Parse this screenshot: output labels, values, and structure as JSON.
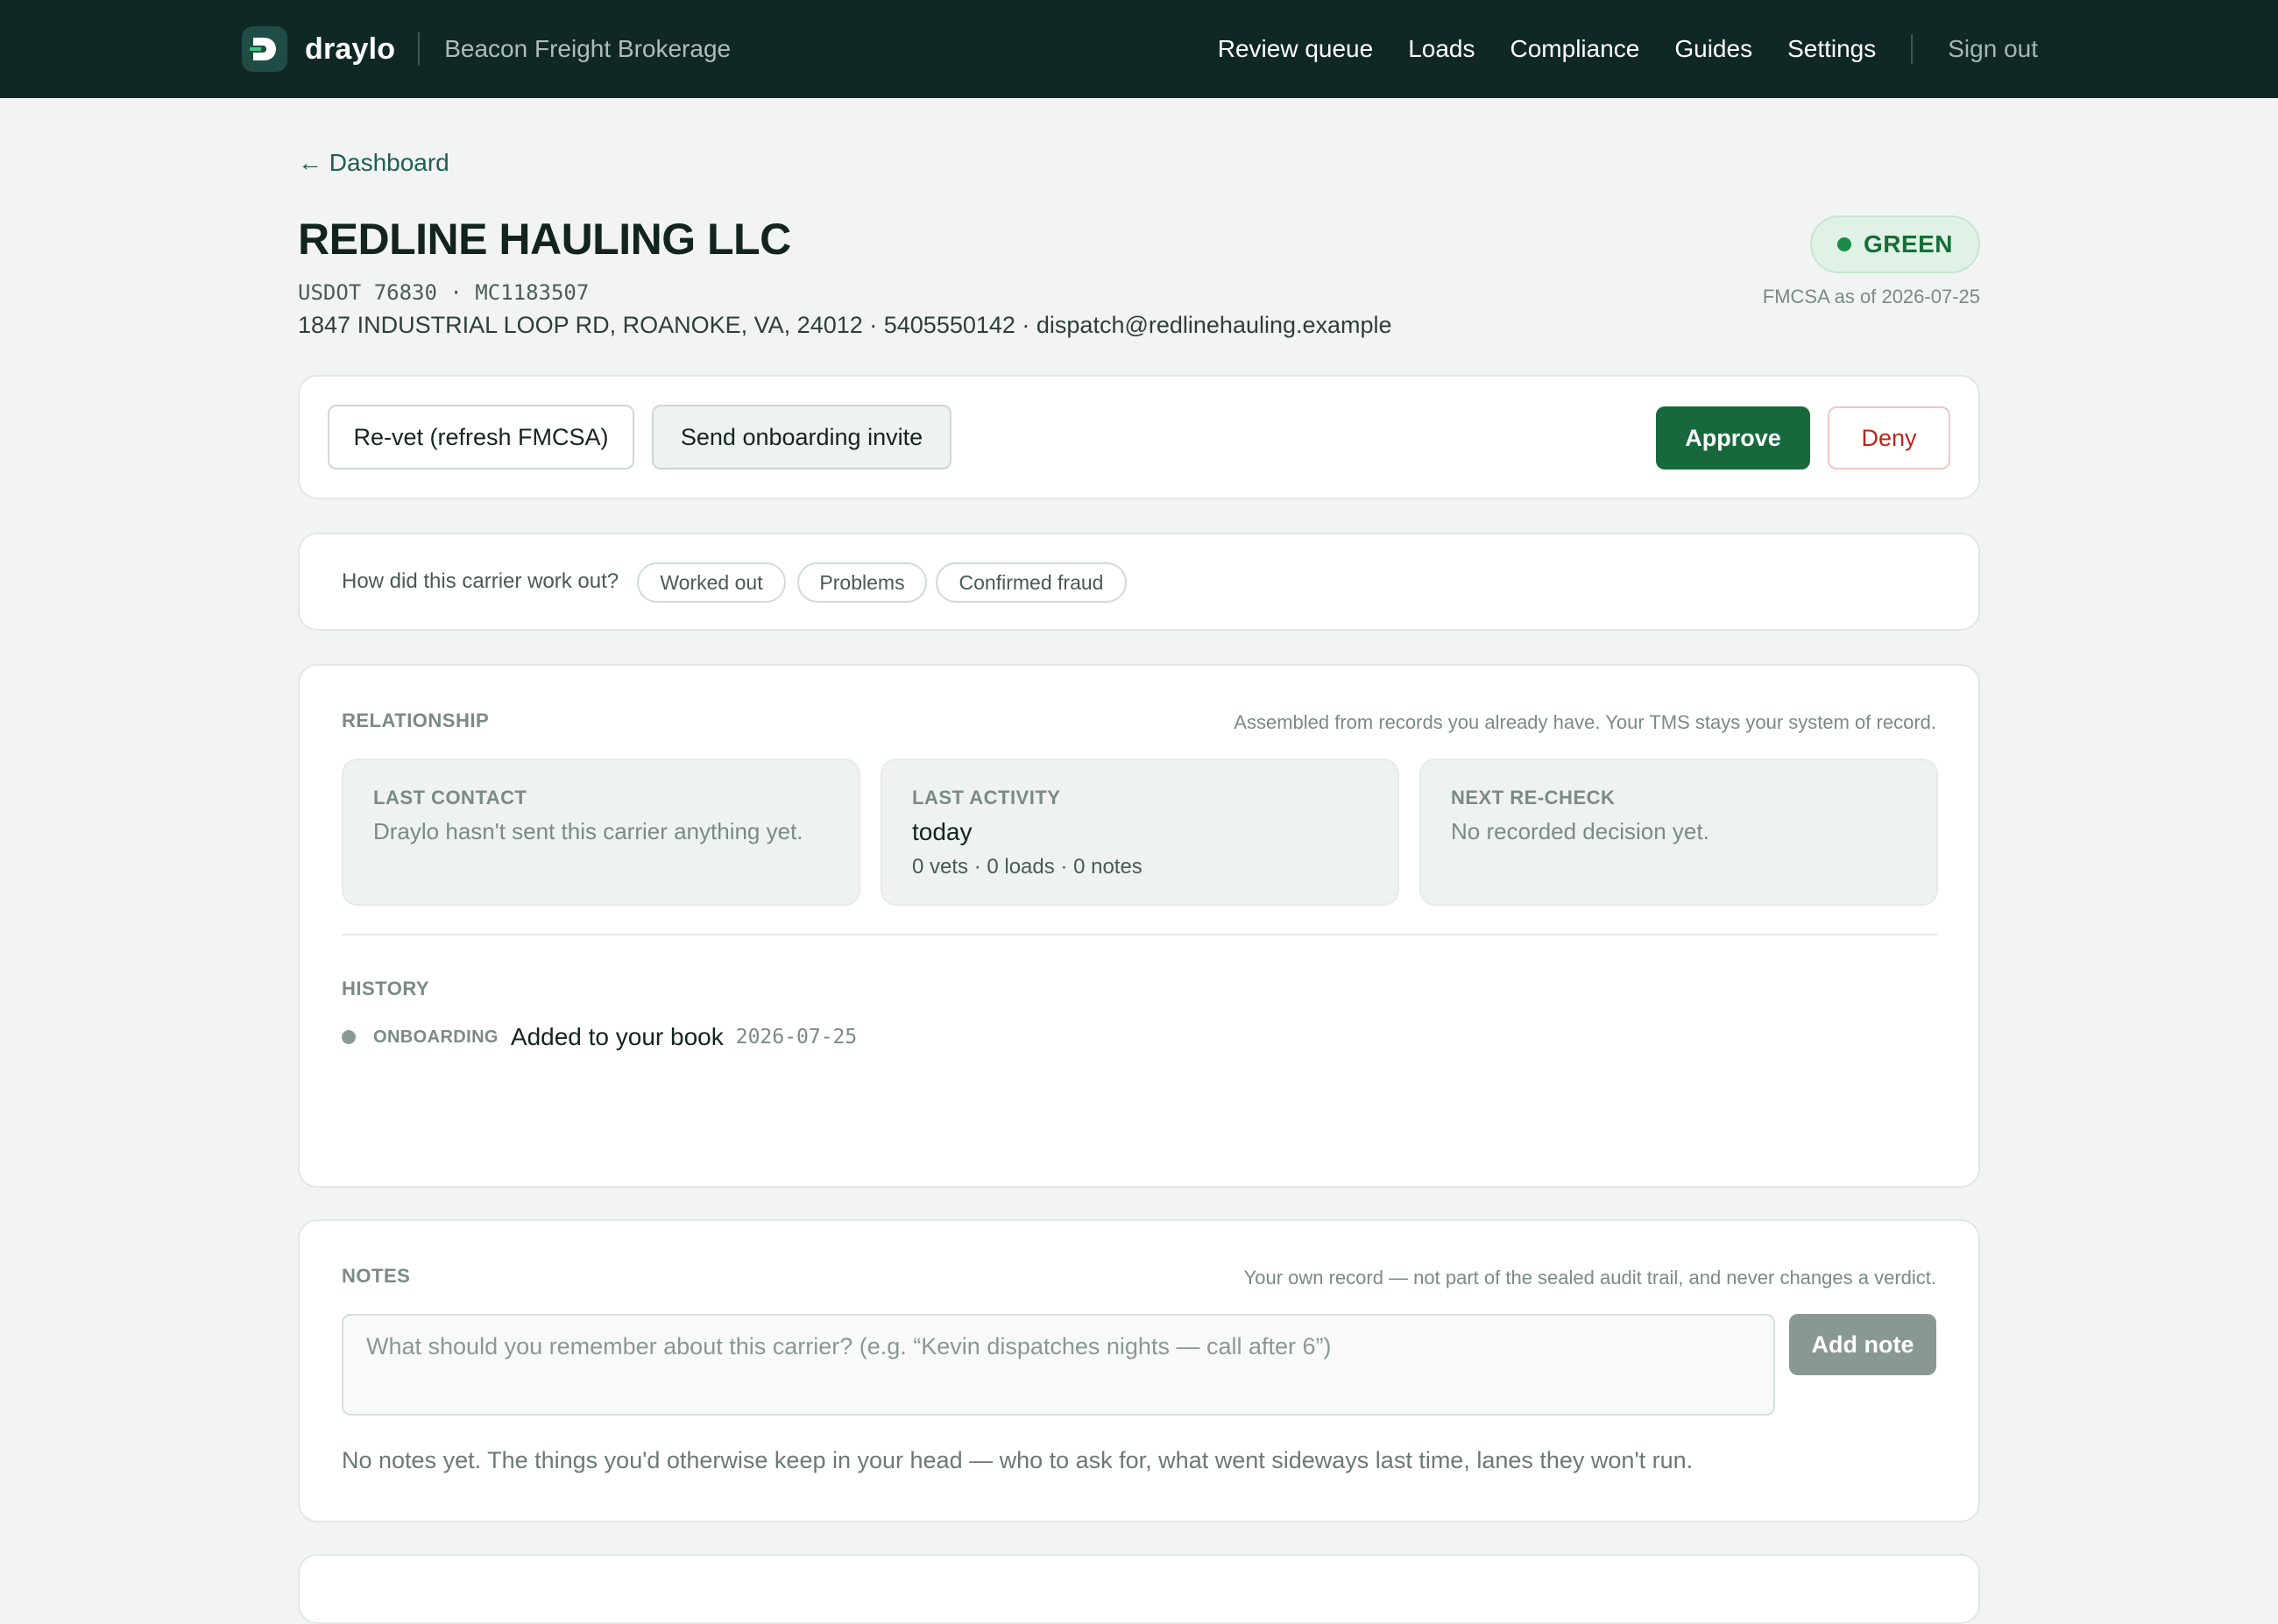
{
  "app": {
    "name": "draylo",
    "org": "Beacon Freight Brokerage"
  },
  "nav": {
    "items": [
      "Review queue",
      "Loads",
      "Compliance",
      "Guides",
      "Settings"
    ],
    "sign_out": "Sign out"
  },
  "breadcrumb": "← Dashboard",
  "carrier": {
    "name": "REDLINE HAULING LLC",
    "ids": "USDOT 76830 · MC1183507",
    "contact_line": "1847 INDUSTRIAL LOOP RD, ROANOKE, VA, 24012 · 5405550142 · dispatch@redlinehauling.example",
    "status": "GREEN",
    "status_color": "#1a8a46",
    "status_as_of": "FMCSA as of 2026-07-25"
  },
  "actions": {
    "revet": "Re-vet (refresh FMCSA)",
    "invite": "Send onboarding invite",
    "approve": "Approve",
    "deny": "Deny"
  },
  "feedback": {
    "question": "How did this carrier work out?",
    "options": [
      "Worked out",
      "Problems",
      "Confirmed fraud"
    ]
  },
  "relationship": {
    "heading": "RELATIONSHIP",
    "note": "Assembled from records you already have. Your TMS stays your system of record.",
    "last_contact": {
      "label": "LAST CONTACT",
      "text": "Draylo hasn't sent this carrier anything yet."
    },
    "last_activity": {
      "label": "LAST ACTIVITY",
      "value": "today",
      "detail": "0 vets · 0 loads · 0 notes"
    },
    "next_recheck": {
      "label": "NEXT RE-CHECK",
      "text": "No recorded decision yet."
    }
  },
  "history": {
    "heading": "HISTORY",
    "items": [
      {
        "tag": "ONBOARDING",
        "text": "Added to your book",
        "date": "2026-07-25"
      }
    ]
  },
  "notes": {
    "heading": "NOTES",
    "note": "Your own record — not part of the sealed audit trail, and never changes a verdict.",
    "placeholder": "What should you remember about this carrier? (e.g. “Kevin dispatches nights — call after 6”)",
    "add_button": "Add note",
    "empty": "No notes yet. The things you'd otherwise keep in your head — who to ask for, what went sideways last time, lanes they won't run."
  },
  "colors": {
    "topbar": "#0f2826",
    "accent": "#17693c",
    "deny": "#b8261b"
  }
}
